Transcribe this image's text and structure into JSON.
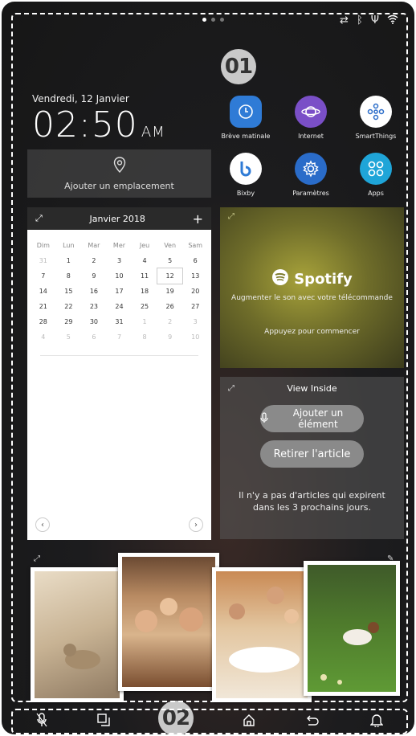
{
  "status_icons": [
    "cast-icon",
    "bluetooth-icon",
    "usb-icon",
    "wifi-icon"
  ],
  "callouts": {
    "top": "01",
    "bottom": "02"
  },
  "clock": {
    "date": "Vendredi, 12 Janvier",
    "time": "02:50",
    "ampm": "AM"
  },
  "location": {
    "label": "Ajouter un emplacement"
  },
  "apps": [
    {
      "label": "Brève matinale",
      "icon": "clock-icon",
      "color": "#2f7bd6"
    },
    {
      "label": "Internet",
      "icon": "planet-icon",
      "color": "#7a4fc7"
    },
    {
      "label": "SmartThings",
      "icon": "smartthings-icon",
      "color": "#ffffff"
    },
    {
      "label": "Bixby",
      "icon": "bixby-icon",
      "color": "#ffffff"
    },
    {
      "label": "Paramètres",
      "icon": "gear-icon",
      "color": "#2a6cc9"
    },
    {
      "label": "Apps",
      "icon": "apps-icon",
      "color": "#1fa5d8"
    }
  ],
  "calendar": {
    "title": "Janvier 2018",
    "days": [
      "Dim",
      "Lun",
      "Mar",
      "Mer",
      "Jeu",
      "Ven",
      "Sam"
    ],
    "cells": [
      "31",
      "1",
      "2",
      "3",
      "4",
      "5",
      "6",
      "7",
      "8",
      "9",
      "10",
      "11",
      "12",
      "13",
      "14",
      "15",
      "16",
      "17",
      "18",
      "19",
      "20",
      "21",
      "22",
      "23",
      "24",
      "25",
      "26",
      "27",
      "28",
      "29",
      "30",
      "31",
      "1",
      "2",
      "3",
      "4",
      "5",
      "6",
      "7",
      "8",
      "9",
      "10"
    ]
  },
  "spotify": {
    "brand": "Spotify",
    "subtitle": "Augmenter le son avec votre télécommande",
    "cta": "Appuyez pour commencer"
  },
  "view_inside": {
    "title": "View Inside",
    "add_label": "Ajouter un élément",
    "remove_label": "Retirer l'article",
    "message": "Il n'y a pas d'articles qui expirent dans les 3 prochains jours."
  },
  "bottom_nav": [
    "mic-icon",
    "recent-apps-icon",
    "home-icon",
    "back-icon",
    "bell-icon"
  ],
  "colors": {
    "accent": "#2f7bd6",
    "spotify_bg": "#8c8a34"
  }
}
